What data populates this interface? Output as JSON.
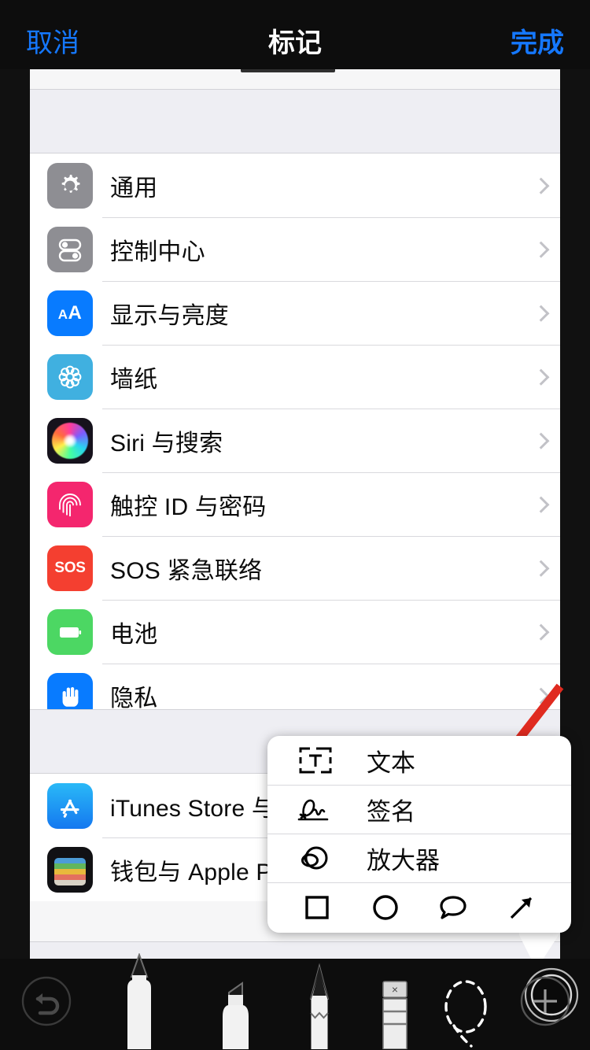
{
  "nav": {
    "cancel_label": "取消",
    "title": "标记",
    "done_label": "完成"
  },
  "settings": {
    "group_one": [
      {
        "label": "通用",
        "icon": "gear-icon",
        "color": "#8e8e93"
      },
      {
        "label": "控制中心",
        "icon": "toggles-icon",
        "color": "#8e8e93"
      },
      {
        "label": "显示与亮度",
        "icon": "aa-text-icon",
        "color": "#087bff"
      },
      {
        "label": "墙纸",
        "icon": "wallpaper-icon",
        "color": "#40b0e0"
      },
      {
        "label": "Siri 与搜索",
        "icon": "siri-orb-icon",
        "color": "#16121c"
      },
      {
        "label": "触控 ID 与密码",
        "icon": "fingerprint-icon",
        "color": "#f4266e"
      },
      {
        "label": "SOS 紧急联络",
        "icon": "sos-icon",
        "color": "#f43f30"
      },
      {
        "label": "电池",
        "icon": "battery-icon",
        "color": "#4cd763"
      },
      {
        "label": "隐私",
        "icon": "hand-icon",
        "color": "#087bff"
      }
    ],
    "group_two": [
      {
        "label": "iTunes Store 与",
        "icon": "app-store-icon",
        "color": "#1478f0"
      },
      {
        "label": "钱包与 Apple P",
        "icon": "wallet-icon",
        "color": "#111114"
      }
    ],
    "chevron": "chevron-right-icon"
  },
  "popup": {
    "items": [
      {
        "label": "文本",
        "icon": "text-box-icon"
      },
      {
        "label": "签名",
        "icon": "signature-icon"
      },
      {
        "label": "放大器",
        "icon": "magnifier-icon"
      }
    ],
    "shapes": [
      {
        "name": "square-shape-icon"
      },
      {
        "name": "circle-shape-icon"
      },
      {
        "name": "speech-bubble-shape-icon"
      },
      {
        "name": "arrow-shape-icon"
      }
    ]
  },
  "toolbar": {
    "tools": [
      {
        "name": "undo-button"
      },
      {
        "name": "pen-tool"
      },
      {
        "name": "highlighter-tool"
      },
      {
        "name": "pencil-tool"
      },
      {
        "name": "eraser-tool",
        "badge": "×"
      },
      {
        "name": "lasso-tool"
      },
      {
        "name": "color-swatch"
      },
      {
        "name": "add-button"
      }
    ]
  },
  "annotation": {
    "arrow_color": "#e02b20",
    "points_to": "放大器"
  },
  "colors": {
    "accent_blue": "#1578ff",
    "nav_background": "#0d0d0d",
    "list_background": "#ffffff",
    "band_background": "#eeeef3",
    "toolbar_background": "#0d0d0d"
  }
}
